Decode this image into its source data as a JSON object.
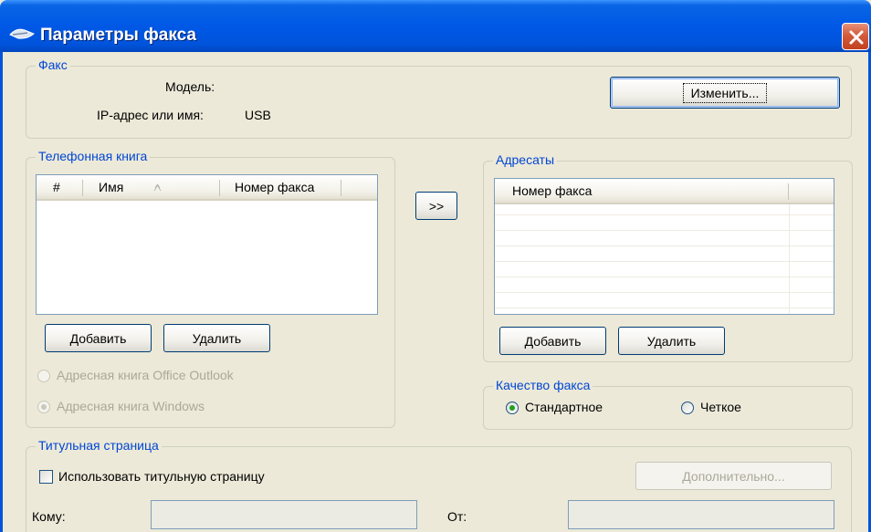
{
  "window": {
    "title": "Параметры факса"
  },
  "fax": {
    "legend": "Факс",
    "model_label": "Модель:",
    "model_value": "",
    "ip_label": "IP-адрес или имя:",
    "ip_value": "USB",
    "change_button": "Изменить..."
  },
  "phonebook": {
    "legend": "Телефонная книга",
    "columns": [
      "#",
      "Имя",
      "Номер факса"
    ],
    "add_button": "Добавить",
    "delete_button": "Удалить",
    "sources": [
      {
        "label": "Адресная книга Office Outlook",
        "checked": false,
        "enabled": false
      },
      {
        "label": "Адресная книга Windows",
        "checked": true,
        "enabled": false
      }
    ]
  },
  "transfer_button": ">>",
  "recipients": {
    "legend": "Адресаты",
    "columns": [
      "Номер факса"
    ],
    "add_button": "Добавить",
    "delete_button": "Удалить"
  },
  "quality": {
    "legend": "Качество факса",
    "options": [
      {
        "label": "Стандартное",
        "checked": true
      },
      {
        "label": "Четкое",
        "checked": false
      }
    ]
  },
  "cover_page": {
    "legend": "Титульная страница",
    "use_checkbox_label": "Использовать титульную страницу",
    "use_checked": false,
    "advanced_button": "Дополнительно...",
    "to_label": "Кому:",
    "to_value": "",
    "from_label": "От:",
    "from_value": ""
  },
  "colors": {
    "titlebar": "#0054DC",
    "group_legend": "#0046D5",
    "close_button": "#D25B3B",
    "dialog_bg": "#ECE9D8",
    "radio_check": "#21A121"
  }
}
